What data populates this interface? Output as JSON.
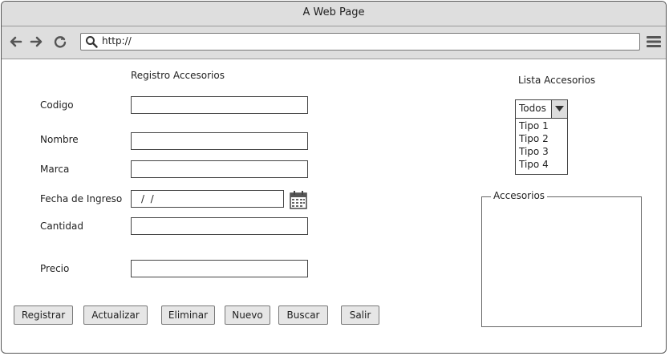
{
  "window": {
    "title": "A Web Page"
  },
  "browser": {
    "url": "http://",
    "icons": [
      "back-arrow-icon",
      "forward-arrow-icon",
      "reload-icon",
      "search-icon",
      "hamburger-menu-icon"
    ]
  },
  "form": {
    "title": "Registro Accesorios",
    "fields": {
      "codigo_label": "Codigo",
      "nombre_label": "Nombre",
      "marca_label": "Marca",
      "fecha_label": "Fecha de Ingreso",
      "fecha_value": "/  /",
      "cantidad_label": "Cantidad",
      "precio_label": "Precio"
    },
    "buttons": {
      "registrar": "Registrar",
      "actualizar": "Actualizar",
      "eliminar": "Eliminar",
      "nuevo": "Nuevo",
      "buscar": "Buscar",
      "salir": "Salir"
    }
  },
  "lista": {
    "title": "Lista Accesorios",
    "select_value": "Todos",
    "options": [
      "Tipo 1",
      "Tipo 2",
      "Tipo 3",
      "Tipo 4"
    ],
    "group_label": "Accesorios"
  }
}
